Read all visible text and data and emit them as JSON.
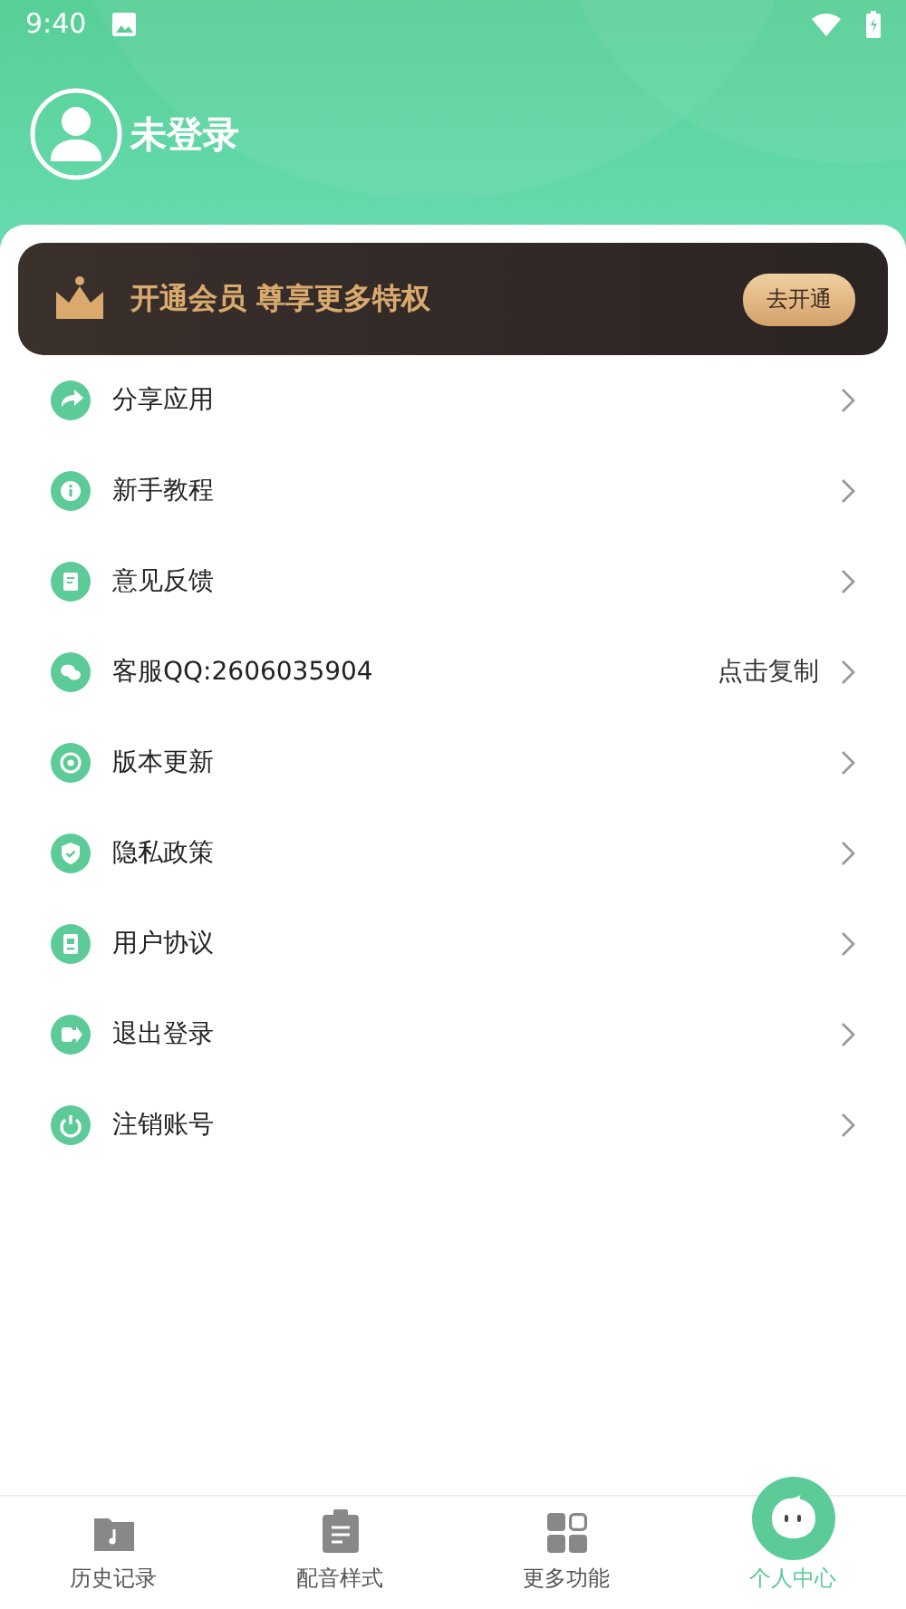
{
  "status_bar": {
    "time": "9:40"
  },
  "profile": {
    "name": "未登录"
  },
  "vip_banner": {
    "text": "开通会员 尊享更多特权",
    "button": "去开通"
  },
  "menu": [
    {
      "label": "分享应用"
    },
    {
      "label": "新手教程"
    },
    {
      "label": "意见反馈"
    },
    {
      "label": "客服QQ:2606035904",
      "action": "点击复制"
    },
    {
      "label": "版本更新"
    },
    {
      "label": "隐私政策"
    },
    {
      "label": "用户协议"
    },
    {
      "label": "退出登录"
    },
    {
      "label": "注销账号"
    }
  ],
  "tabs": [
    {
      "label": "历史记录",
      "selected": false
    },
    {
      "label": "配音样式",
      "selected": false
    },
    {
      "label": "更多功能",
      "selected": false
    },
    {
      "label": "个人中心",
      "selected": true
    }
  ]
}
